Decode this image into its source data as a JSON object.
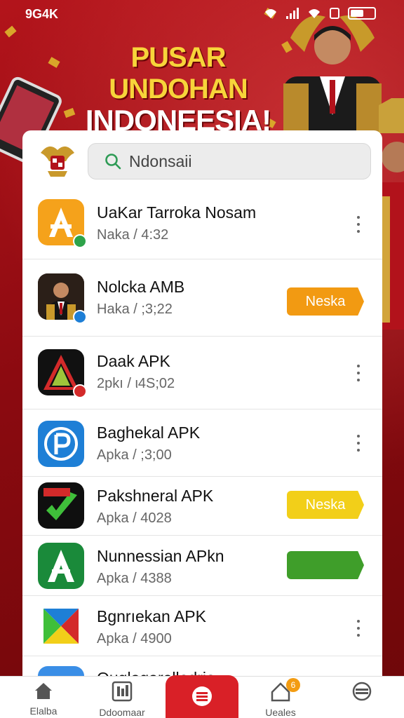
{
  "status_bar": {
    "carrier": "9G4K"
  },
  "banner": {
    "line1": "PUSAR UNDOHAN",
    "line2": "INDONEESIA!"
  },
  "search": {
    "value": "Ndonsaii"
  },
  "apps": [
    {
      "name": "UaKar Tarroka Nosam",
      "meta": "Naka  / 4:32",
      "action": "menu",
      "icon_color": "#f5a21b",
      "icon": "a-logo-icon"
    },
    {
      "name": "Nolcka AMB",
      "meta": "Haka  / ;3;22",
      "action": "Neska",
      "action_color": "#f29a12",
      "icon_color": "#3a2a20",
      "icon": "portrait-icon"
    },
    {
      "name": "Daak APK",
      "meta": "2pkı / ι4S;02",
      "action": "menu",
      "icon_color": "#111111",
      "icon": "triangle-a-icon"
    },
    {
      "name": "Baghekal APK",
      "meta": "Apka  / ;3;00",
      "action": "menu",
      "icon_color": "#1e7fd6",
      "icon": "p-logo-icon"
    },
    {
      "name": "Pakshneral APK",
      "meta": "Apka  / 4028",
      "action": "Neska",
      "action_color": "#f2cf19",
      "icon_color": "#0f0f0f",
      "icon": "check-logo-icon"
    },
    {
      "name": "Nunnessian APkn",
      "meta": "Apka  / 4388",
      "action": "",
      "action_color": "#3f9e2a",
      "icon_color": "#1a8a3a",
      "icon": "green-a-icon"
    },
    {
      "name": "Bgnrıekan APK",
      "meta": "Apka  / 4900",
      "action": "menu",
      "icon_color": "#ffffff",
      "icon": "play-logo-icon"
    },
    {
      "name": "Ouqlagarelledria",
      "meta": "",
      "action": "",
      "icon_color": "#3a8ee6",
      "icon": "blue-app-icon"
    }
  ],
  "bottom_nav": {
    "items": [
      "Elalba",
      "Ddoomaar",
      "",
      "Ueales",
      ""
    ],
    "notification_count": "6"
  },
  "colors": {
    "primary_red": "#d92027",
    "banner_yellow": "#f7d43a"
  }
}
